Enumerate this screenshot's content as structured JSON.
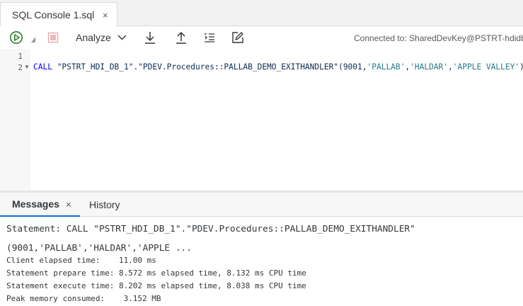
{
  "tab": {
    "title": "SQL Console 1.sql",
    "close": "×"
  },
  "toolbar": {
    "analyze_label": "Analyze",
    "connection": "Connected to: SharedDevKey@PSTRT-hdidb-c"
  },
  "editor": {
    "line_numbers": [
      "1",
      "2"
    ],
    "code": {
      "keyword": "CALL",
      "proc": " \"PSTRT_HDI_DB_1\".\"PDEV.Procedures::PALLAB_DEMO_EXITHANDLER\"(9001,",
      "arg1": "'PALLAB'",
      "sep1": ",",
      "arg2": "'HALDAR'",
      "sep2": ",",
      "arg3": "'APPLE VALLEY'",
      "close": ")"
    }
  },
  "messages": {
    "tabs": {
      "messages": "Messages",
      "close": "×",
      "history": "History"
    },
    "statement_line1": "Statement: CALL \"PSTRT_HDI_DB_1\".\"PDEV.Procedures::PALLAB_DEMO_EXITHANDLER\"",
    "statement_line2": "(9001,'PALLAB','HALDAR','APPLE ...",
    "stats": [
      "Client elapsed time:    11.00 ms",
      "Statement prepare time: 8.572 ms elapsed time, 8.132 ms CPU time",
      "Statement execute time: 8.202 ms elapsed time, 8.038 ms CPU time",
      "Peak memory consumed:    3.152 MB"
    ]
  },
  "colors": {
    "run_green": "#2b7d2b",
    "stop_pink": "#e9a3ab",
    "active_tab_underline": "#0a6ed1",
    "keyword_blue": "#0000ff",
    "string_teal": "#267a87"
  },
  "icons": [
    "close-icon",
    "run-icon",
    "run-options-caret-icon",
    "stop-icon",
    "chevron-down-icon",
    "download-icon",
    "upload-icon",
    "format-code-icon",
    "edit-icon",
    "fold-caret-icon"
  ]
}
